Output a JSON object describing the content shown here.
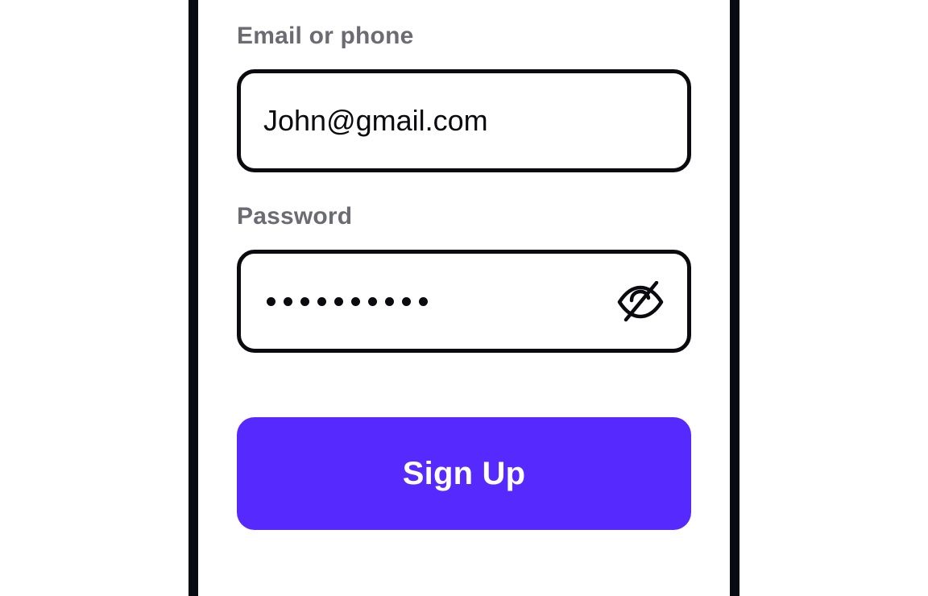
{
  "form": {
    "email": {
      "label": "Email or phone",
      "value": "John@gmail.com"
    },
    "password": {
      "label": "Password",
      "masked_length": 10,
      "toggle_icon": "eye-off-icon"
    },
    "submit_label": "Sign Up"
  },
  "colors": {
    "primary": "#5629ff",
    "label_gray": "#6b6b73",
    "border_dark": "#0a0a0f"
  }
}
